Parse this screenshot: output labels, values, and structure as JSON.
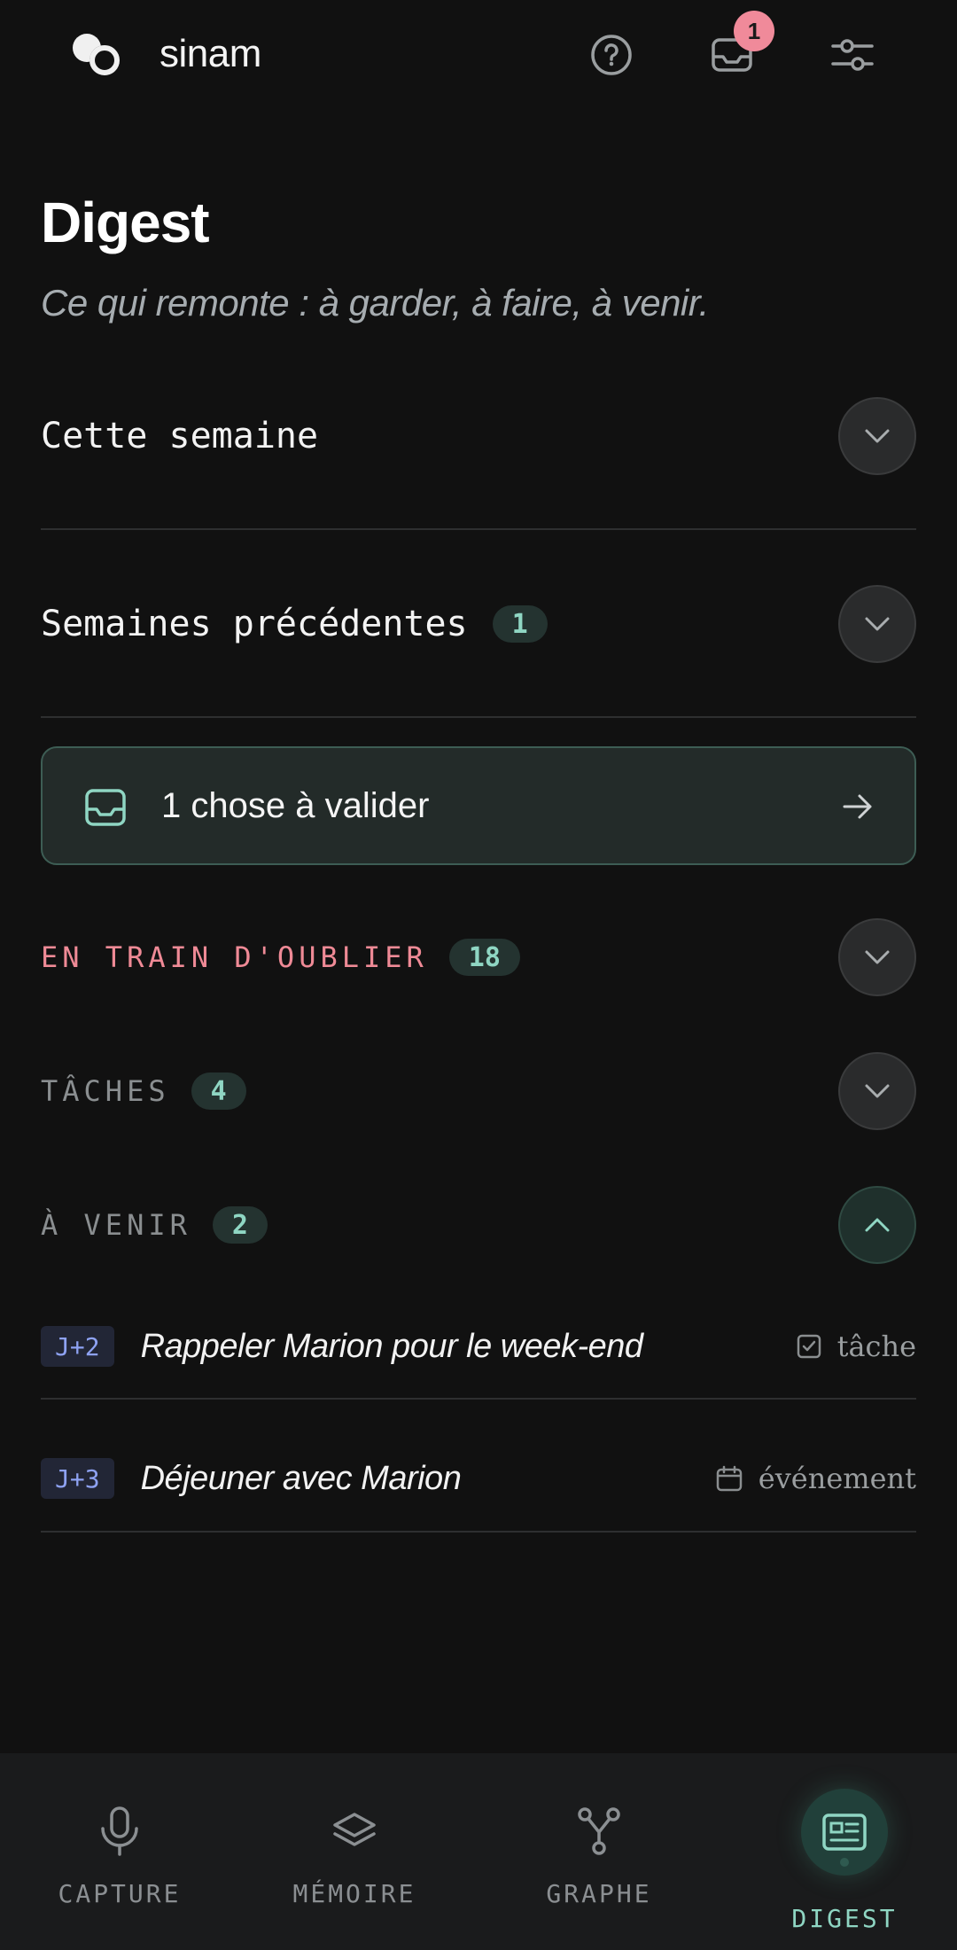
{
  "app": {
    "name": "sinam",
    "inbox_badge": "1"
  },
  "header": {
    "title": "Digest",
    "subtitle": "Ce qui remonte : à garder, à faire, à venir."
  },
  "sections": {
    "this_week": {
      "label": "Cette semaine"
    },
    "previous_weeks": {
      "label": "Semaines précédentes",
      "count": "1"
    },
    "validate": {
      "label": "1 chose à valider"
    },
    "forgetting": {
      "label": "EN TRAIN D'OUBLIER",
      "count": "18"
    },
    "tasks": {
      "label": "TÂCHES",
      "count": "4"
    },
    "upcoming": {
      "label": "À VENIR",
      "count": "2",
      "expanded": true
    }
  },
  "upcoming_items": [
    {
      "day": "J+2",
      "title": "Rappeler Marion pour le week-end",
      "kind": "tâche",
      "kind_icon": "checkbox-icon"
    },
    {
      "day": "J+3",
      "title": "Déjeuner avec Marion",
      "kind": "événement",
      "kind_icon": "calendar-icon"
    }
  ],
  "nav": {
    "items": [
      {
        "label": "CAPTURE",
        "icon": "microphone-icon"
      },
      {
        "label": "MÉMOIRE",
        "icon": "layers-icon"
      },
      {
        "label": "GRAPHE",
        "icon": "graph-icon"
      },
      {
        "label": "DIGEST",
        "icon": "newspaper-icon",
        "active": true
      }
    ]
  },
  "colors": {
    "background": "#111111",
    "accent": "#8fd6c3",
    "alert": "#ef8a96",
    "badge": "#f08a9a",
    "day_tag": "#8ea2f2"
  }
}
